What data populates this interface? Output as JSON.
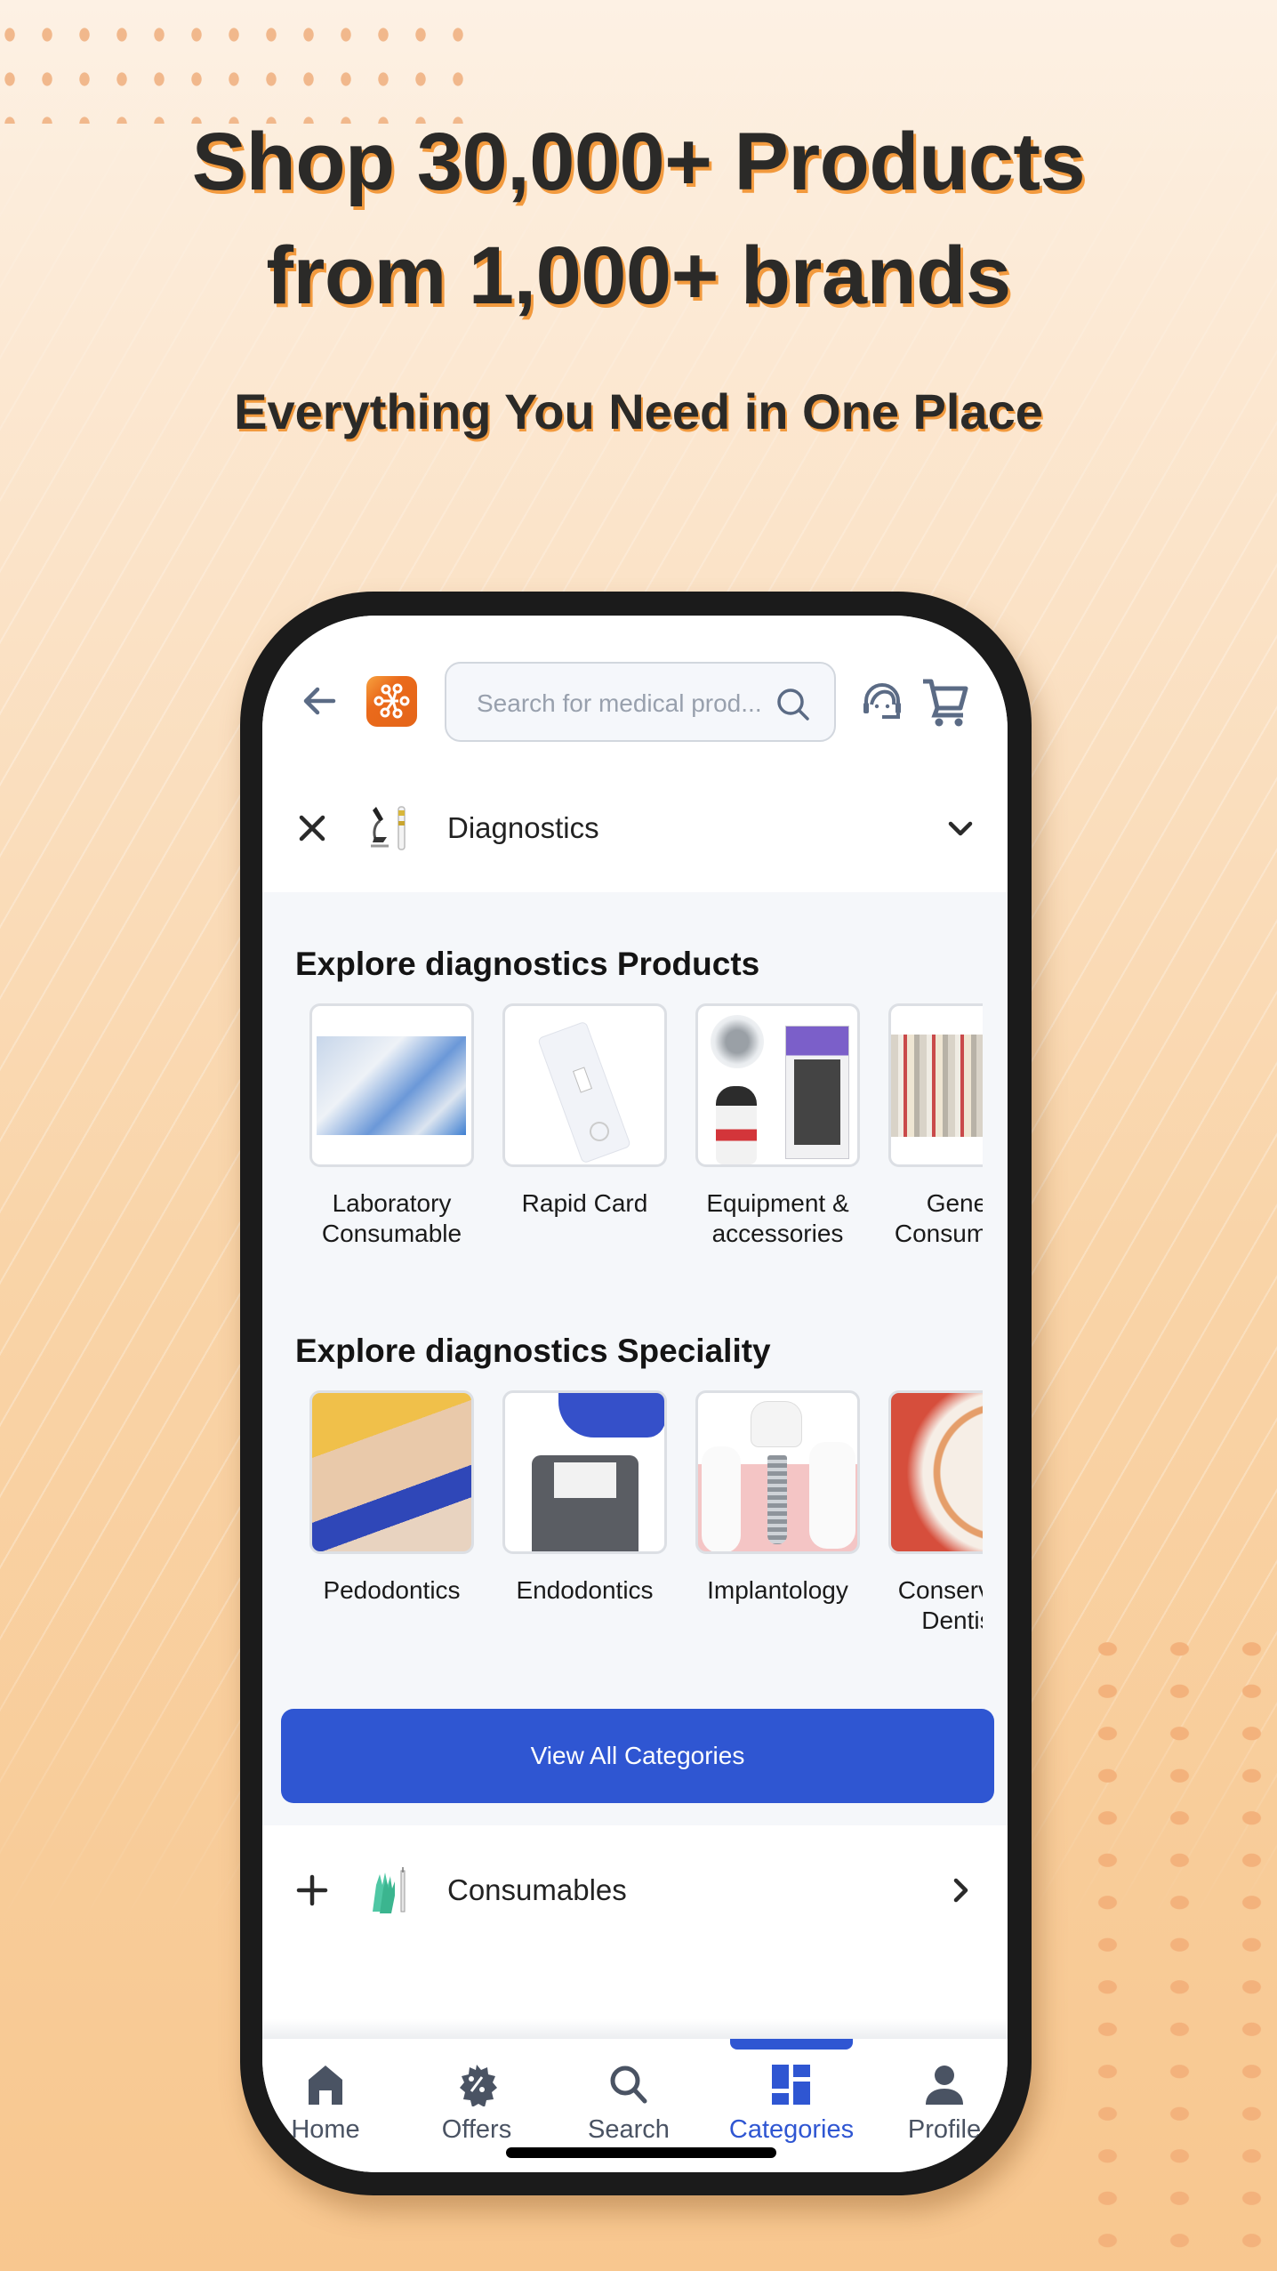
{
  "promo": {
    "headline_line1": "Shop 30,000+ Products",
    "headline_line2": "from 1,000+ brands",
    "subheadline": "Everything You Need in One Place"
  },
  "colors": {
    "accent_blue": "#2f56d2",
    "logo_orange": "#e8691b",
    "headline_shadow": "#f29a3e",
    "icon_gray": "#4a5363"
  },
  "header": {
    "back_icon": "arrow-left-icon",
    "logo_icon": "app-logo",
    "search": {
      "placeholder": "Search for medical prod...",
      "value": ""
    },
    "support_icon": "customer-support-icon",
    "cart_icon": "shopping-cart-icon"
  },
  "expanded_category": {
    "label": "Diagnostics",
    "left_icon": "close-icon",
    "thumb": "microscope-test-tube",
    "right_icon": "chevron-down-icon"
  },
  "products_section": {
    "title": "Explore diagnostics Products",
    "items": [
      {
        "label": "Laboratory\nConsumable"
      },
      {
        "label": "Rapid Card"
      },
      {
        "label": "Equipment &\naccessories"
      },
      {
        "label": "General\nConsumables"
      }
    ]
  },
  "speciality_section": {
    "title": "Explore diagnostics Speciality",
    "items": [
      {
        "label": "Pedodontics"
      },
      {
        "label": "Endodontics"
      },
      {
        "label": "Implantology"
      },
      {
        "label": "Conservative\nDentistry"
      }
    ]
  },
  "view_all_button": "View All Categories",
  "collapsed_category": {
    "label": "Consumables",
    "left_icon": "plus-icon",
    "thumb": "gloves-syringe",
    "right_icon": "chevron-right-icon"
  },
  "bottom_nav": {
    "active": "Categories",
    "items": [
      {
        "label": "Home",
        "icon": "home-icon"
      },
      {
        "label": "Offers",
        "icon": "offer-badge-icon"
      },
      {
        "label": "Search",
        "icon": "search-icon"
      },
      {
        "label": "Categories",
        "icon": "grid-icon"
      },
      {
        "label": "Profile",
        "icon": "user-icon"
      }
    ]
  }
}
